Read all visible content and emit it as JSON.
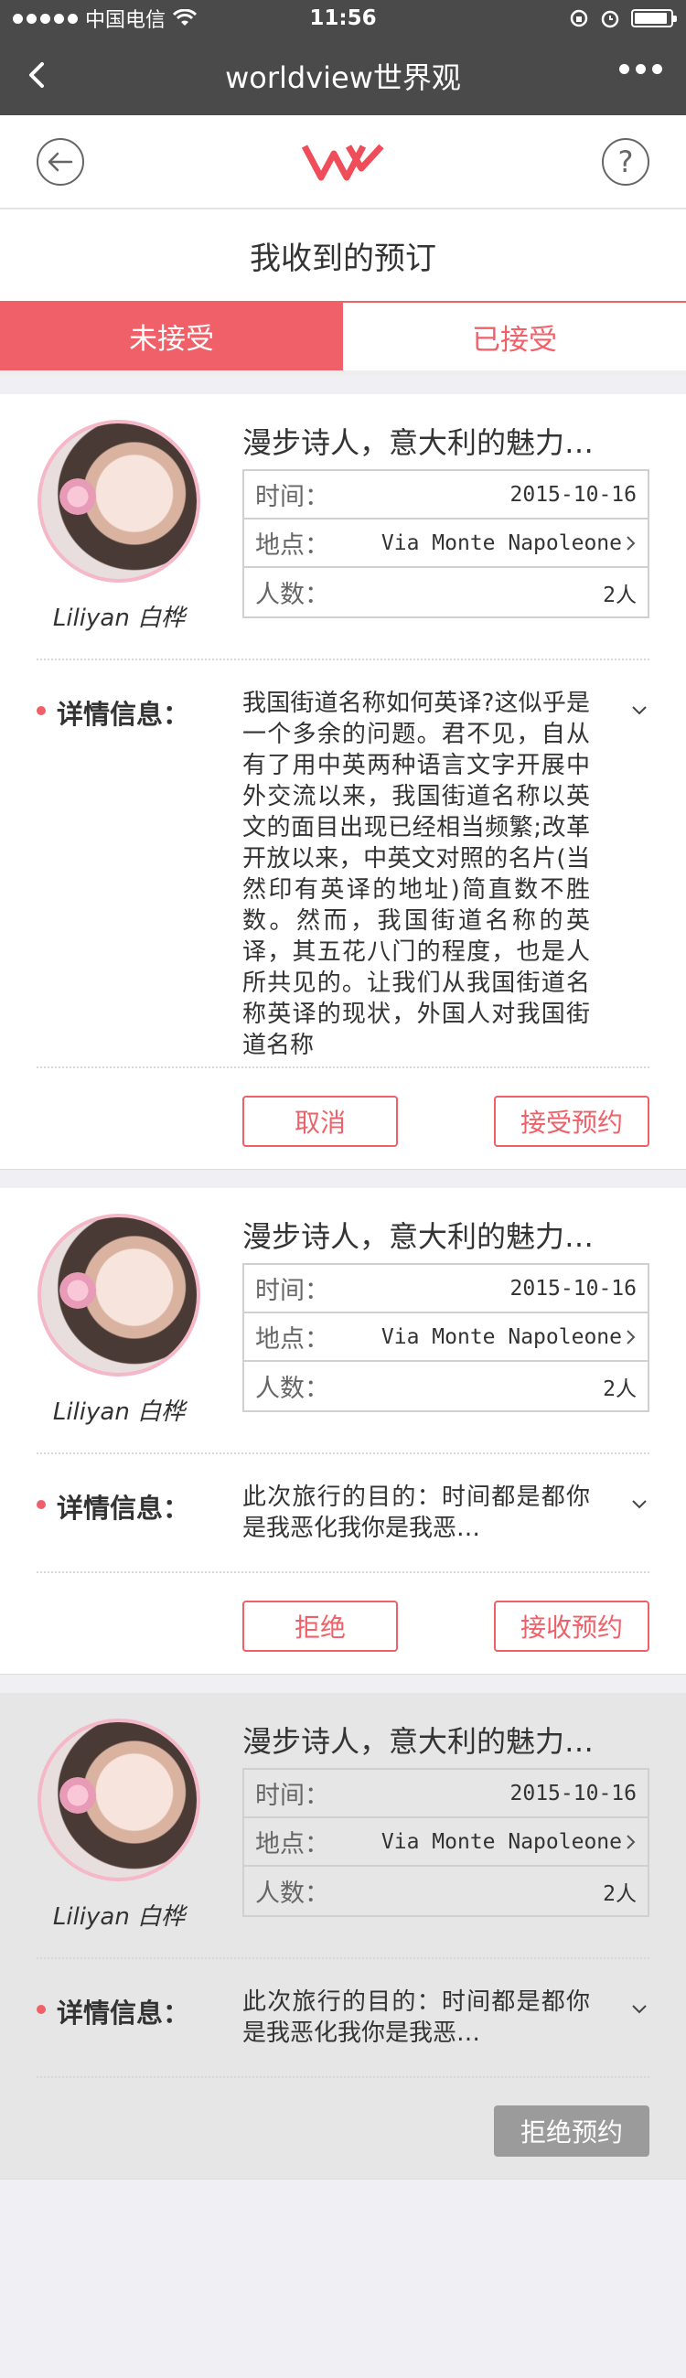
{
  "status_bar": {
    "carrier": "中国电信",
    "time": "11:56"
  },
  "nav": {
    "title": "worldview世界观"
  },
  "section_title": "我收到的预订",
  "tabs": [
    {
      "label": "未接受"
    },
    {
      "label": "已接受"
    }
  ],
  "labels": {
    "time": "时间：",
    "place": "地点：",
    "people": "人数：",
    "detail": "详情信息："
  },
  "cards": [
    {
      "username": "Liliyan 白桦",
      "title": "漫步诗人，意大利的魅力…",
      "time": "2015-10-16",
      "place": "Via Monte Napoleone",
      "people": "2人",
      "detail": "我国街道名称如何英译?这似乎是一个多余的问题。君不见，自从有了用中英两种语言文字开展中外交流以来，我国街道名称以英文的面目出现已经相当频繁;改革开放以来，中英文对照的名片(当然印有英译的地址)简直数不胜数。然而，我国街道名称的英译，其五花八门的程度，也是人所共见的。让我们从我国街道名称英译的现状，外国人对我国街道名称",
      "btn_left": "取消",
      "btn_right": "接受预约"
    },
    {
      "username": "Liliyan 白桦",
      "title": "漫步诗人，意大利的魅力…",
      "time": "2015-10-16",
      "place": "Via Monte Napoleone",
      "people": "2人",
      "detail": "此次旅行的目的：时间都是都你是我恶化我你是我恶…",
      "btn_left": "拒绝",
      "btn_right": "接收预约"
    },
    {
      "username": "Liliyan 白桦",
      "title": "漫步诗人，意大利的魅力…",
      "time": "2015-10-16",
      "place": "Via Monte Napoleone",
      "people": "2人",
      "detail": "此次旅行的目的：时间都是都你是我恶化我你是我恶…",
      "btn_right": "拒绝预约"
    }
  ],
  "colors": {
    "accent": "#f06068",
    "nav_bg": "#4a4a4a",
    "disabled": "#9b9b9b"
  }
}
